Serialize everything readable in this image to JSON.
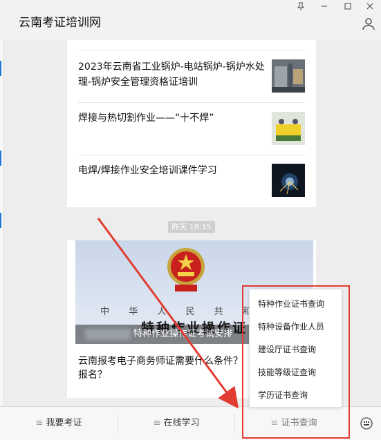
{
  "app": {
    "title": "云南考证培训网"
  },
  "window_controls": [
    "pin-icon",
    "minimize-icon",
    "maximize-icon",
    "close-icon"
  ],
  "articles": [
    {
      "title": "2023年云南省工业锅炉-电站锅炉-锅炉水处理-锅炉安全管理资格证培训"
    },
    {
      "title": "焊接与热切割作业——“十不焊”"
    },
    {
      "title": "电焊/焊接作业安全培训课件学习"
    }
  ],
  "timestamp": "昨天  18:15",
  "cover": {
    "line1": "中 华 人 民 共 和 国",
    "line2": "特种作业操作证",
    "caption": "特种作业操作证考试安排"
  },
  "article2": {
    "title": "云南报考电子商务师证需要什么条件？报名？"
  },
  "bottom_menu": {
    "tabs": [
      {
        "label": "我要考证"
      },
      {
        "label": "在线学习"
      },
      {
        "label": "证书查询"
      }
    ]
  },
  "popup_menu": {
    "items": [
      "特种作业证书查询",
      "特种设备作业人员",
      "建设厅证书查询",
      "技能等级证查询",
      "学历证书查询"
    ]
  },
  "colors": {
    "highlight_red": "#e23b32",
    "background": "#ededed"
  }
}
